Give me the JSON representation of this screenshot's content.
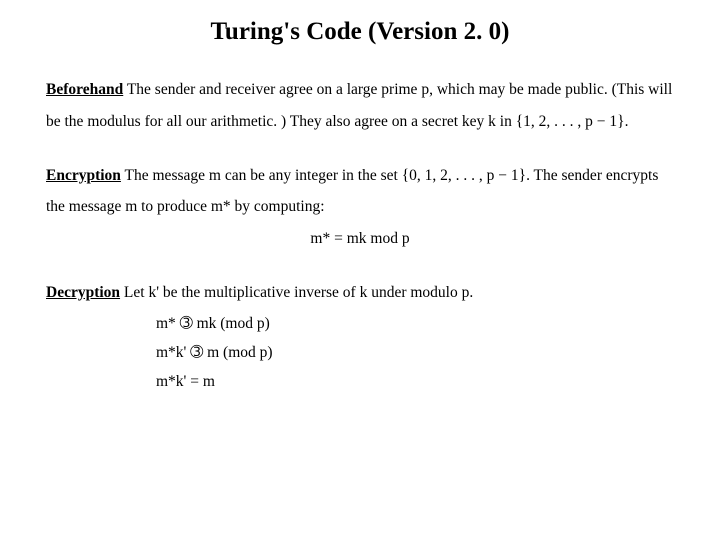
{
  "title": "Turing's Code (Version 2. 0)",
  "sections": {
    "beforehand": {
      "label": "Beforehand",
      "text": " The sender and receiver agree on a large prime p, which may be made public. (This will be the modulus for all our arithmetic. ) They also agree on a secret key k in {1, 2, . . . , p − 1}."
    },
    "encryption": {
      "label": "Encryption",
      "text": " The message m can be any integer in the set {0, 1, 2, . . . , p − 1}. The sender encrypts the message m to produce m* by computing:",
      "equation": "m* = mk mod p"
    },
    "decryption": {
      "label": "Decryption",
      "text": " Let k' be the multiplicative inverse of k under modulo p.",
      "lines": {
        "l1a": "m* ",
        "sym": "➂",
        "l1b": " mk  (mod p)",
        "l2a": "m*k' ",
        "l2b": " m   (mod p)",
        "l3": "m*k' = m"
      }
    }
  }
}
